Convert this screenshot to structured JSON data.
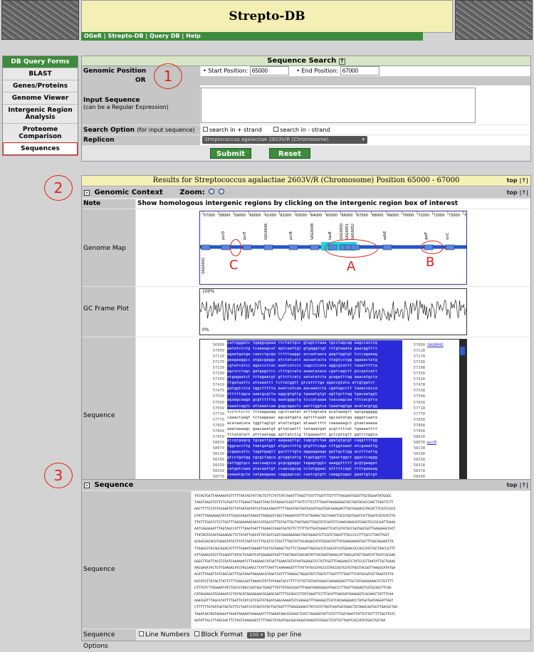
{
  "header": {
    "title": "Strepto-DB"
  },
  "nav": {
    "items": [
      "OGeR",
      "Strepto-DB",
      "Query DB",
      "Help"
    ]
  },
  "sidebar": {
    "title": "DB Query Forms",
    "items": [
      {
        "label": "BLAST"
      },
      {
        "label": "Genes/Proteins"
      },
      {
        "label": "Genome Viewer"
      },
      {
        "label": "Intergenic Region Analysis"
      },
      {
        "label": "Proteome Comparison"
      },
      {
        "label": "Sequences"
      }
    ]
  },
  "search": {
    "title": "Sequence Search",
    "genomic_position_label": "Genomic Position",
    "start_label": "• Start Position:",
    "start_value": "65000",
    "end_label": "• End Position:",
    "end_value": "67000",
    "or_label": "OR",
    "input_seq_label": "Input Sequence",
    "input_seq_sub": "(can be a Regular Expression)",
    "option_label": "Search Option",
    "option_sub": "(for input sequence)",
    "plus_strand": "search in + strand",
    "minus_strand": "search in - strand",
    "replicon_label": "Replicon",
    "replicon_value": "Streptococcus agalactiae 2603V/R (Chromosome)",
    "submit": "Submit",
    "reset": "Reset"
  },
  "results": {
    "title": "Results for Streptococcus agalactiae 2603V/R (Chromosome) Position 65000 - 67000",
    "top": "top |↑|",
    "context_label": "Genomic Context",
    "zoom_label": "Zoom:",
    "note_label": "Note",
    "note_text": "Show homologous intergenic regions by clicking on the intergenic region box of interest",
    "genome_map_label": "Genome Map",
    "gc_label": "GC Frame Plot",
    "gc_top": "100%",
    "gc_bottom": "0%",
    "sequence_label": "Sequence",
    "genes": [
      "purD",
      "purE",
      "SAG0046",
      "purB",
      "SAG0048",
      "tauB",
      "SAG0050",
      "SAG0051",
      "SAG0052",
      "adhE",
      "galP",
      "tsrC",
      "SAG0042"
    ],
    "scale_ticks": [
      "57000",
      "58000",
      "59000",
      "60000",
      "61000",
      "62000",
      "63000",
      "64000",
      "65000",
      "66000",
      "67000",
      "68000",
      "69000",
      "70000",
      "71000",
      "72000",
      "73000",
      "74000"
    ],
    "left_positions": [
      "56999",
      "57059",
      "57119",
      "57179",
      "57239",
      "57299",
      "57359",
      "57419",
      "57479",
      "57539",
      "57599",
      "57659",
      "57719",
      "57779",
      "57839",
      "57899",
      "57959",
      "58019",
      "58079",
      "58139",
      "58199",
      "58259",
      "58319",
      "58379",
      "58439",
      "58499",
      "58559",
      "58619"
    ],
    "right_positions": [
      "57058",
      "57118",
      "57178",
      "57238",
      "57298",
      "57358",
      "57418",
      "57478",
      "57538",
      "57598",
      "57658",
      "57718",
      "57778",
      "57838",
      "57898",
      "57958",
      "58018",
      "58078",
      "58138",
      "58198",
      "58258",
      "58318",
      "58378",
      "58438",
      "58498",
      "58558",
      "58618",
      "58678"
    ],
    "right_links": {
      "0": "SAG0042",
      "17": "purD"
    },
    "seq_lines": [
      "cattgggatc tgaggcgaaa ttctattgcc gtagtctaaa tgcctagcag aagccacctg",
      "aatatctctg tcaaaagcat agtcaattgt gtgaggtcgt tttgtaaata gaacggtttt",
      "agaatgatga caacctgcga tttttaaggc accaataaca gagttggtgt tcccagaaag",
      "gaagaaggcc atgacgaggc atctatcatt aacaatacta ttagtcctgg agaaactatg",
      "cgtatcatcc agaccctcac aaatcatccc cagcctcata aggcgtattt taaattttta",
      "agctcctagc gatgagctcc ctttgccata aaaatasaca cgatcagctt gtcaatcatt",
      "atgagaatct tctagaacgt gttcttcatc aatatatcta gcagatttag aaacatgcta",
      "ttgataattc atsaaattt tcttatggtt gtcattttga agaccgtata attgtgatct",
      "gatggtctca tggcttttta aaatcatcaa aacaaatcta cgatagcctt taaaccacca",
      "ttttttagca aaacgcgtta aggcgtgttg tgaaatgtgt agttgcttag tgacaatggt",
      "agaagcaaga gcgttttttg aaatgggctg tcccataaaa taacaagcaa tttcacgtta",
      "taaatcagtc attaaatcaa gagcagactc aatttggtca taaatagtga acatacgtgg",
      "tcctctcctc tttaagaaag cgcttaatat atttagtata acataaagtt agtgaggggg",
      "caaactaagt tctaagaaac agcaatgata agttttaaat agcaatatga aggatcaata",
      "acataatata tggttagtgt atattatgat ataaattttt caaaaaagct gtaataaaaa",
      "aaataaaagc gaacaaatgt gttataattt tataaatgat acgtttttat tgaaaatttt",
      "tttatatatt atttaatagg agttatctcg ttgaaaattt gctcgttgtt ggttctggta",
      "gtcgtgagcg tgcgattgct aagaagttgc tagcgtctaa ggatgtgcgt caggttttgg",
      "tggcaccttg taatgatggt atgacctttg gtgtttcaga cttggtaaat atcgaaattg",
      "ccgaacattc tagatgagtt gacttttgta aggaagaaga gattgcttgg acctttattg",
      "gtcctgatgg cgcgctagca gctggtattg ttgatggttt tgaactggct ggactcaggg",
      "tattggtgcc aaccaagcca gcgcggaggc tagagtggtc aaaggttttt gcgtgaagat",
      "catgatcaaa atacaattgt ccaacagcag cctatggaac atttttcagt ttttgaaaag",
      "caaaatgcta catgaagaaa caggagccac caatcgtgtt caaggtagac gaattgtcgt",
      "caggcaaggg cgtgatcgtg gctgaaaccg ttgagcaggc gatggatggc gcgcaagaga",
      "tgcttttgaa cagtaaagtt ggcgactcgg gtgcgcggcg ggttatcgaa gaatttttga",
      "atggtgaaga gttctcctt ttcgctttcg ctaatggcga taagttctac atcatgccga",
      "ggcgatggat agcgtttgat aaaaatgatg acgggccaaa gctaaaagcc gataagccaa"
    ],
    "seq_label": "Sequence",
    "seq_text": [
      "TATAGTGATTAAAAAATGTTTTTAATAGTATTACTGTTCTATTATCAAATTTAGGTTCATTTGATTTGTTTTTAGGAATGGGTTGGTGGAATATGGGC",
      "TAAGTAAGCTGTTCTGTGATTCTTGAGGTTGGATTAACTATAAGATCAGTTTATTCTTCCTTTAAATAAGGGAGATACTAATACACCAACTTAGTTCTT",
      "AACTTTTCCTATACAAATGTTATAATAATATCATGACAAGATTTTTAGATAGTGATGCAATGGGTGACGAAGAATTGGTAGAACGTACACTTCGTCCGCA",
      "GTATTTAAGAGAGTATATTGGACAAGATAAGGTTAAAGATCAGCTAAAAATATTTATTGAAGCTGCTAAATTGCGTGATGAGTCATTGGATCATGTGTTA",
      "TTATTTGGCCCTCCTGGTTTAGGGAAAACAACCATGGCATTTGTAATTGCTAATGAGTTGGGTGTCAATCTCAAACAAACATCAGGTCCCGCAATTGAAA",
      "AATCAGGGGATTTAGTAGCCATTTTAAATGATTTAGAACCAGGTGATGTTCTTTTTATTGATGAAATTCATCGTATGCCGATGGCGGTTGAAGAGGTACT",
      "TTATAGTGCAATGGAAGACTTCTATATTGACATTATGATCGGTCAGGAGAAACTAGTAGAGTGTTCATCTAGATTTGCCCCCTTTACCTTAATTGGT",
      "GCAACGACACGTGAGGTATGTTATCTAATCCCTTACGTCCTCGCTTTGGTATTACAGGGCATATGGAGTATTATGAAGAAAATGATTTGACAGAAATTA",
      "TTGAGCGTACAGCAGACATTTTTGAAATGAAAATTACTATGAAGCTGCTTCTGAAATTAGCGCGTCGACGTCGTGGAACGCCACGTATCGCTAACCGTTT",
      "ATTGAAACGTGTTCGAGATTATGCTCAAATCATGGGAGATGGTTTGATAGATGACAATATTACAGATAAAGCATTAACGATGTTAGATATTGATCACGAG",
      "GGGCTTGATTACGTCGATCAAAAAATCTTAAGAACCATGATTGAAATGTATAATGGAGGTCCTGTTGGTTTAGGAACCCTATCCGTTAATATTGCTGAAG",
      "AACGAGATACTGTTGAAGACATGTACGAACCTTATTTAATTCAAAAAGGTTTTATTATGCGTACCCGTACCGGTCGTGTAGCTACGGTTAAGGCATATGA",
      "ACATTTAGGTTATCAGCGATTTGATAAATAAAAACATAAGTCATTTTAAGGCTAGAGTATCTAGTCTTAATTTTTAATTTCATGCAATGTTAAGTATTA",
      "GATATGTTGTAGTTATTCTTTGAGCAGTTAAACGTATTATAAGTACCTTTTTCTGTTATAATAGACCAAAAGGAGTTTGCTATGAAGAAAGTCTGTTTT",
      "GTTTGTCTTGGAAATATCTGCCGTAGCCGATGGCTGAGTTTGTTATGGCGAATTTAGATAAGGAGGATAGCCCTTGGTTGAGAGTCGTGCAGCTTCAA",
      "CATGGGAGCATGGAAATCCTATACATAGGGGAACGCAAGCGATTTTGCAGCGTTATCAAATTCCTTACATTAACGATAAAGGGTCACAACCTATTTCAA",
      "AGACGATTTAGCATATTTTGATTATATCATCGGTATGGATGAGCAAAATGTCAAGGATTTAAAAGCTCATCACAAGGAACCTATGATGATAAGATTAGT",
      "CTTTTTTGTGATGGTGGTGTTCCTGATCCATGGTATACTGGTGATTTTGAGGAAACCTATCGTCTAGTCAATGATGAGCTGTAAACAGTGGTTAACGCTAA",
      "TAAATAATAGTAGAGATTAAGTAGAAATGAAGAATTTTAAAATAACACGAACTCATCTAGAAATATTATCTTTGATAAATTATTGTTGTTTTTGGTTATC",
      "AGTATTACCTTAACGACTTCTAGTCAAGGAGTCTTTAGCTATGATGGCGGCAAGATAAAATATGGGCTCATTGTTAATCACCATATGACTGGTAA"
    ],
    "options_label": "Sequence Options",
    "line_numbers": "Line Numbers",
    "block_format": "Block Format",
    "block_value": "100",
    "bp_per_line": "bp per line"
  },
  "annotations": {
    "c1": "1",
    "c2": "2",
    "c3": "3",
    "a": "A",
    "b": "B",
    "c": "C"
  }
}
